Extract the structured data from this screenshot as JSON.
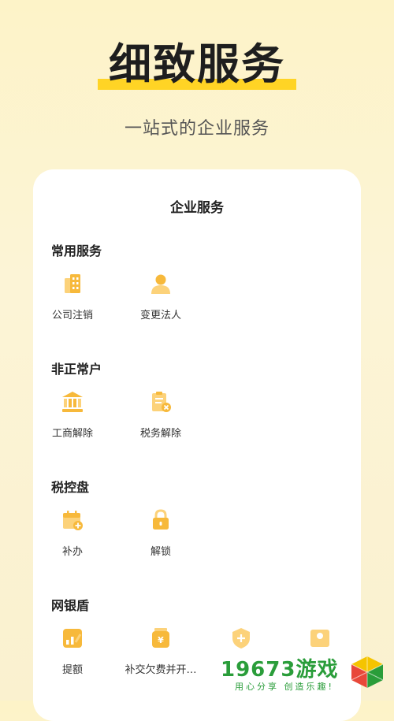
{
  "hero": {
    "title": "细致服务",
    "subtitle": "一站式的企业服务"
  },
  "card": {
    "title": "企业服务",
    "sections": [
      {
        "title": "常用服务",
        "items": [
          {
            "label": "公司注销",
            "icon": "building-icon"
          },
          {
            "label": "变更法人",
            "icon": "person-icon"
          }
        ]
      },
      {
        "title": "非正常户",
        "items": [
          {
            "label": "工商解除",
            "icon": "bank-icon"
          },
          {
            "label": "税务解除",
            "icon": "clipboard-x-icon"
          }
        ]
      },
      {
        "title": "税控盘",
        "items": [
          {
            "label": "补办",
            "icon": "calendar-plus-icon"
          },
          {
            "label": "解锁",
            "icon": "lock-icon"
          }
        ]
      },
      {
        "title": "网银盾",
        "items": [
          {
            "label": "提额",
            "icon": "chart-up-icon"
          },
          {
            "label": "补交欠费并开…",
            "icon": "yuan-jar-icon"
          }
        ]
      }
    ]
  },
  "watermark": {
    "number": "19673游戏",
    "tagline": "用心分享 创造乐趣!"
  },
  "colors": {
    "accent": "#ffd425",
    "icon": "#f7b93b",
    "watermark": "#2a9d3a"
  }
}
